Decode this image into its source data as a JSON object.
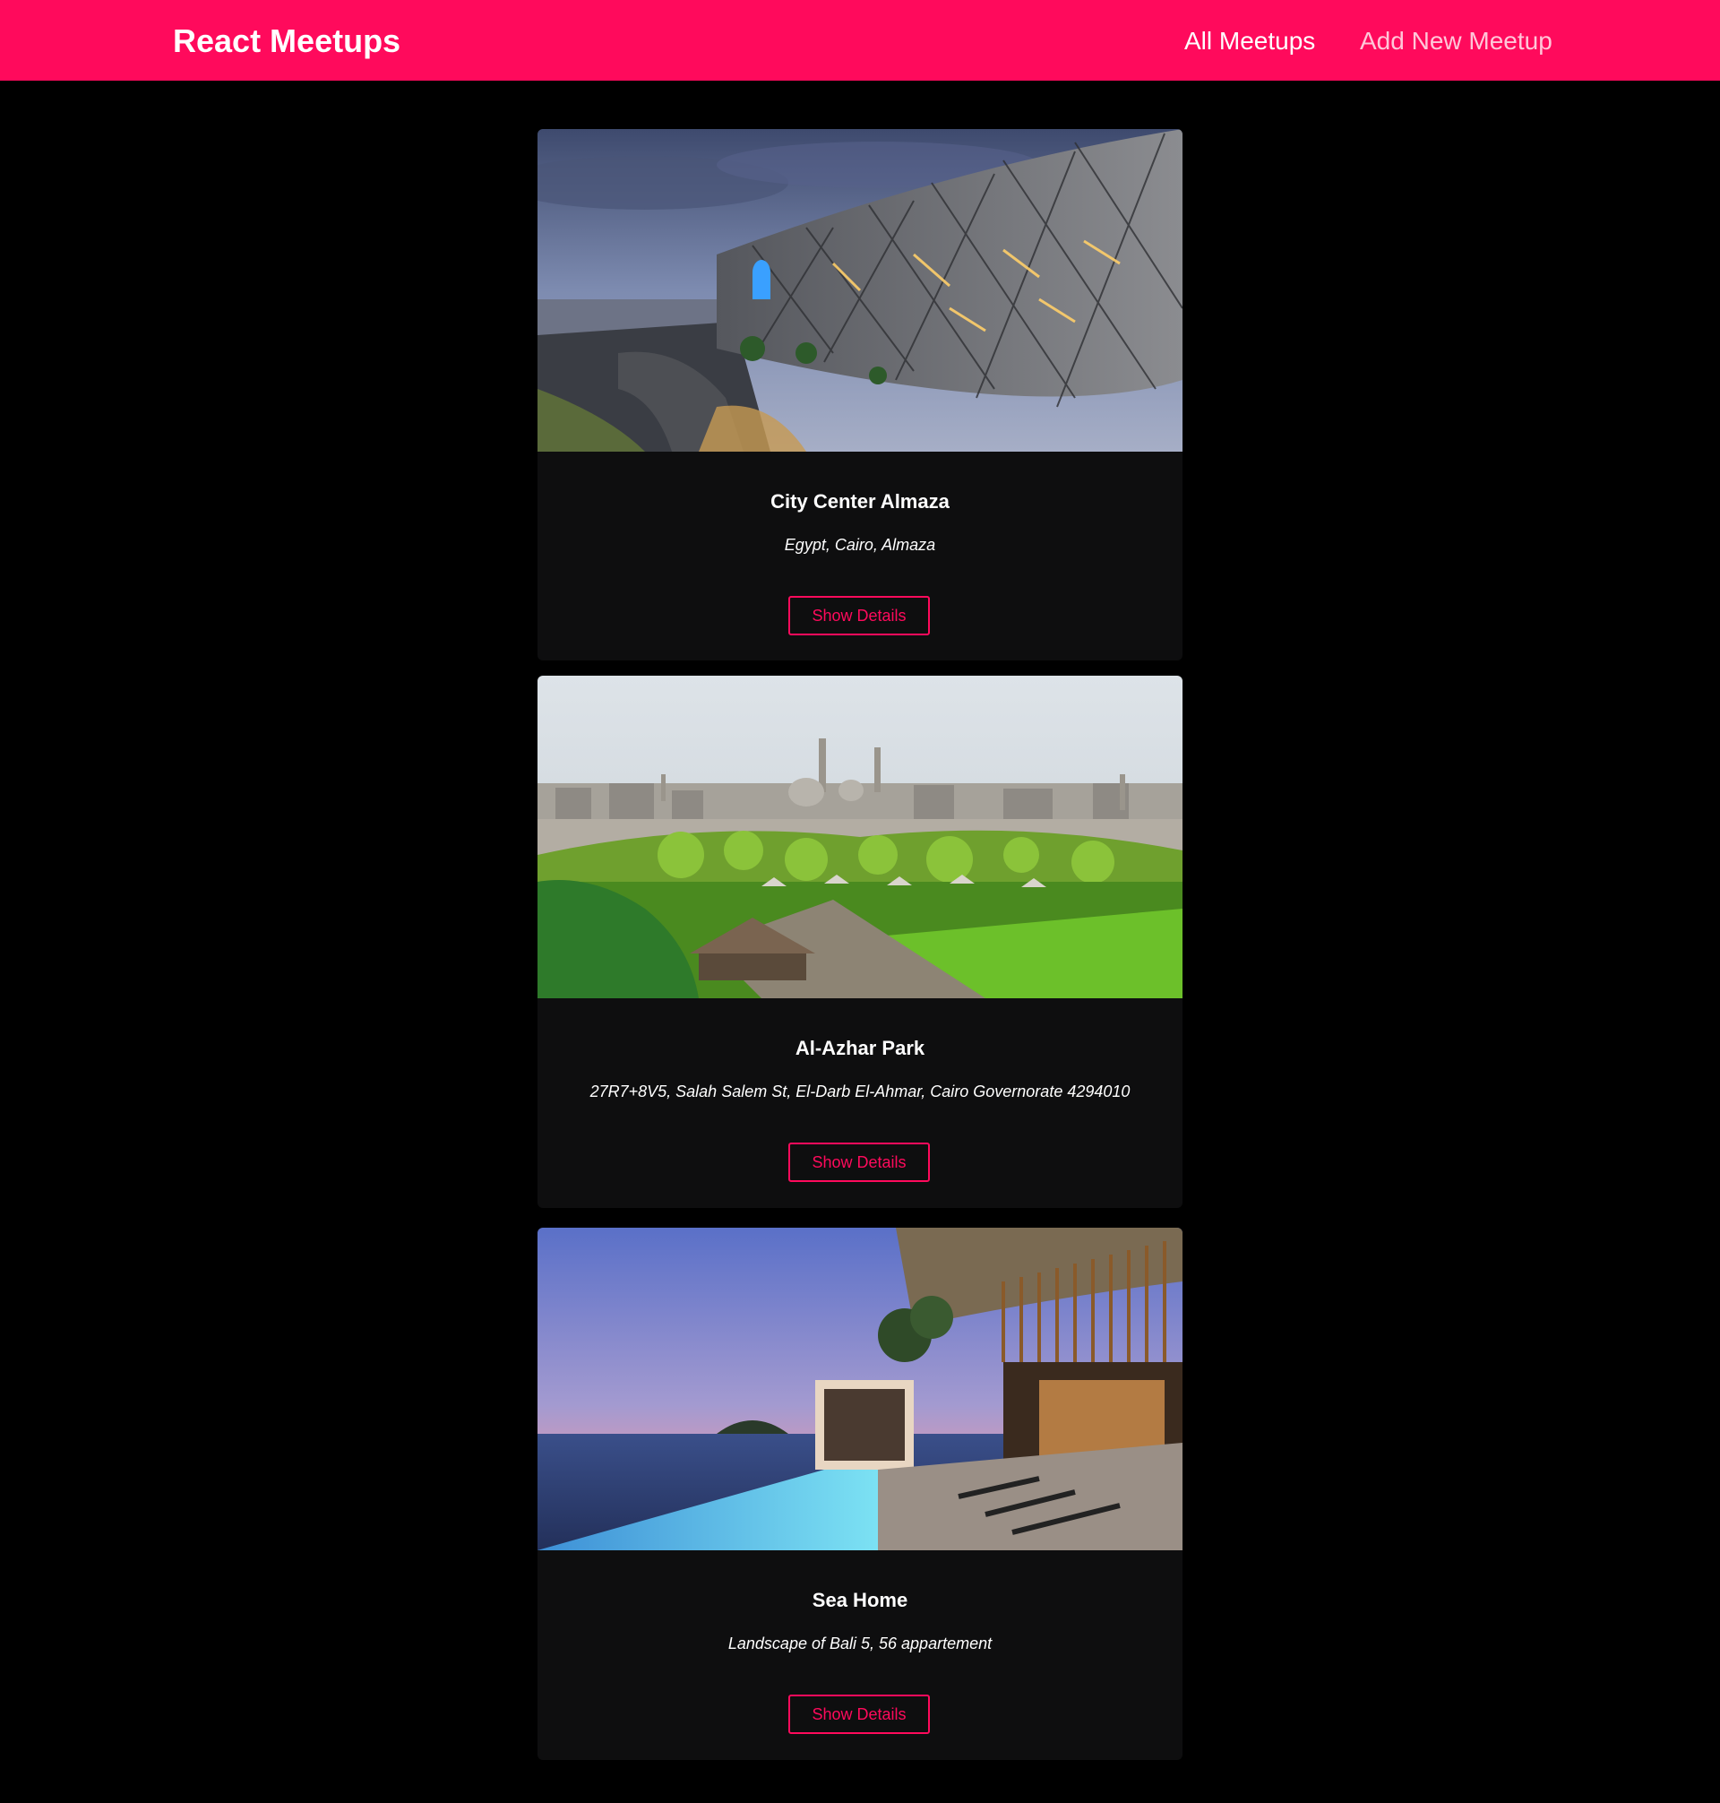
{
  "header": {
    "brand": "React Meetups",
    "nav": {
      "all_meetups": "All Meetups",
      "add_new_meetup": "Add New Meetup"
    }
  },
  "colors": {
    "accent": "#ff0a5c",
    "background": "#000000",
    "card": "#0e0e0f"
  },
  "meetups": [
    {
      "title": "City Center Almaza",
      "address": "Egypt, Cairo, Almaza",
      "button": "Show Details"
    },
    {
      "title": "Al-Azhar Park",
      "address": "27R7+8V5, Salah Salem St, El-Darb El-Ahmar, Cairo Governorate 4294010",
      "button": "Show Details"
    },
    {
      "title": "Sea Home",
      "address": "Landscape of Bali 5, 56 appartement",
      "button": "Show Details"
    }
  ]
}
